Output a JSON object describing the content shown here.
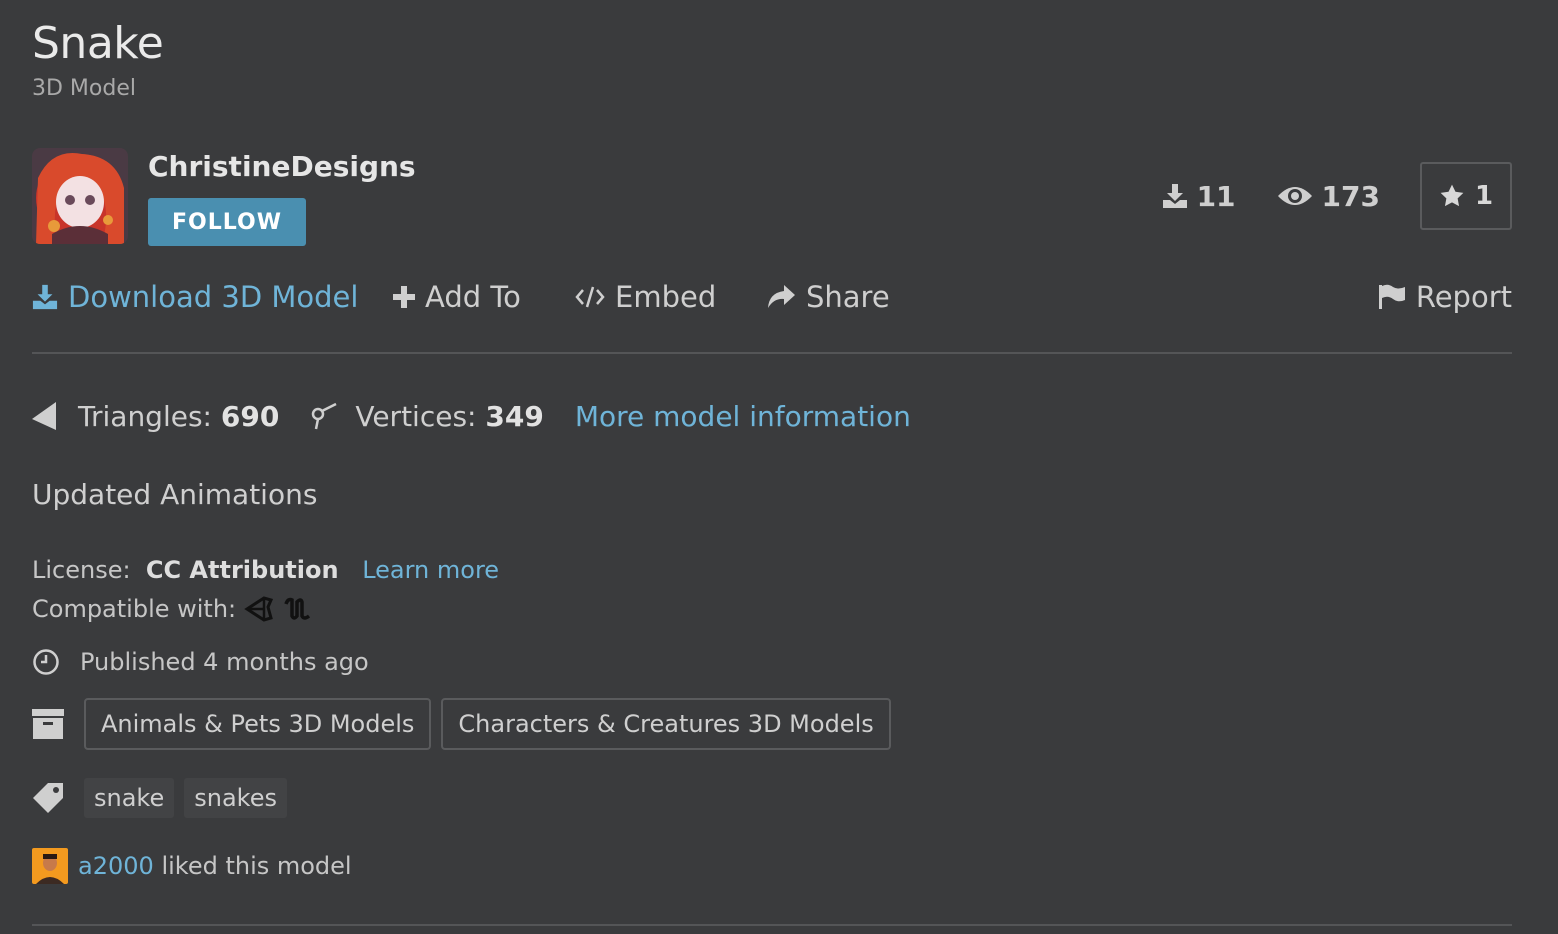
{
  "model": {
    "title": "Snake",
    "subtitle": "3D Model",
    "description": "Updated Animations"
  },
  "author": {
    "name": "ChristineDesigns",
    "follow_label": "FOLLOW"
  },
  "stats": {
    "downloads": "11",
    "views": "173",
    "likes": "1"
  },
  "actions": {
    "download": "Download 3D Model",
    "add_to": "Add To",
    "embed": "Embed",
    "share": "Share",
    "report": "Report"
  },
  "specs": {
    "triangles_label": "Triangles:",
    "triangles_value": "690",
    "vertices_label": "Vertices:",
    "vertices_value": "349",
    "more_info": "More model information"
  },
  "license": {
    "label": "License:",
    "value": "CC Attribution",
    "learn_more": "Learn more",
    "compatible_label": "Compatible with:"
  },
  "published": "Published 4 months ago",
  "categories": [
    "Animals & Pets 3D Models",
    "Characters & Creatures 3D Models"
  ],
  "tags": [
    "snake",
    "snakes"
  ],
  "liked_by": {
    "user": "a2000",
    "text": "liked this model"
  },
  "colors": {
    "background": "#3a3b3d",
    "link": "#6fb4d8",
    "follow_button": "#4a8fb0"
  }
}
